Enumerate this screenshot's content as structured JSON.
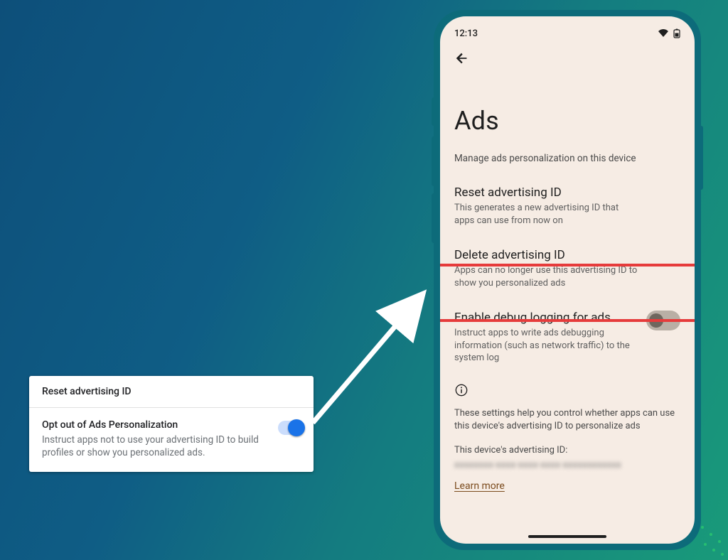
{
  "old_card": {
    "row1_title": "Reset advertising ID",
    "row2_title": "Opt out of Ads Personalization",
    "row2_sub": "Instruct apps not to use your advertising ID to build profiles or show you personalized ads.",
    "toggle_on": true
  },
  "phone": {
    "status_time": "12:13",
    "page_title": "Ads",
    "lead": "Manage ads personalization on this device",
    "settings": [
      {
        "title": "Reset advertising ID",
        "desc": "This generates a new advertising ID that apps can use from now on"
      },
      {
        "title": "Delete advertising ID",
        "desc": "Apps can no longer use this advertising ID to show you personalized ads"
      },
      {
        "title": "Enable debug logging for ads",
        "desc": "Instruct apps to write ads debugging information (such as network traffic) to the system log",
        "toggle_on": false
      }
    ],
    "info_para": "These settings help you control whether apps can use this device's advertising ID to personalize ads",
    "ad_id_label": "This device's advertising ID:",
    "ad_id_value_masked": "xxxxxxxx-xxxx-xxxx-xxxx-xxxxxxxxxxxx",
    "learn_more": "Learn more"
  }
}
